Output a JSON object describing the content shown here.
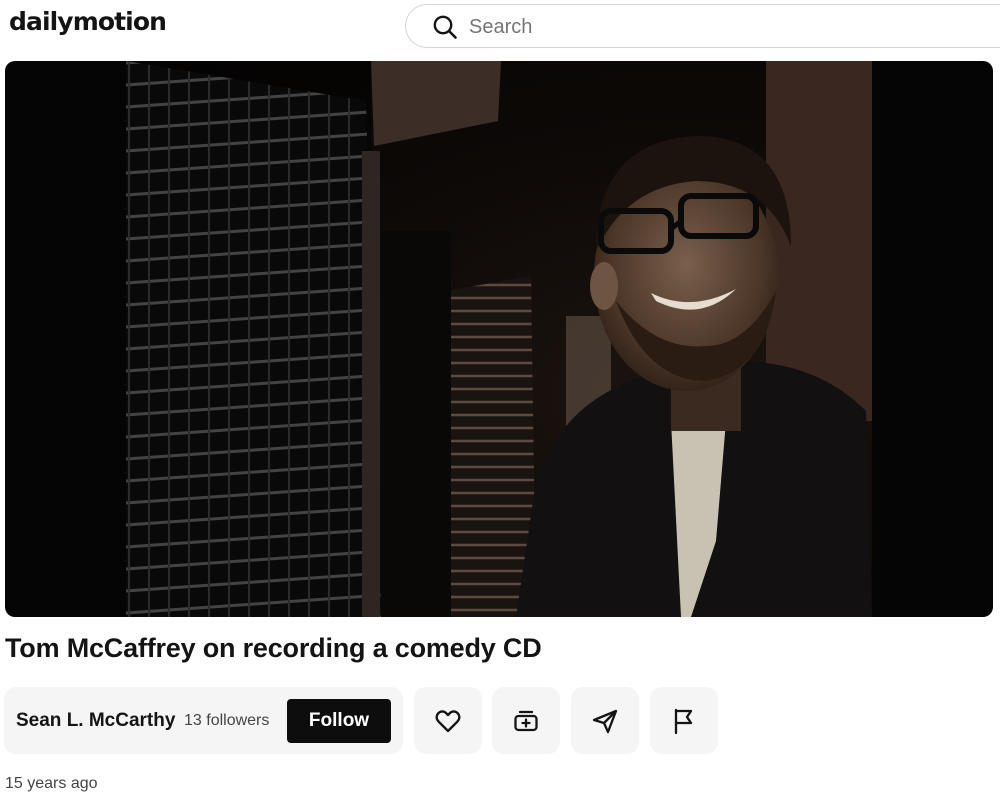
{
  "header": {
    "logo_text": "dailymotion",
    "search": {
      "placeholder": "Search",
      "icon": "search-icon"
    }
  },
  "video": {
    "title": "Tom McCaffrey on recording a comedy CD",
    "posted": "15 years ago"
  },
  "channel": {
    "name": "Sean L. McCarthy",
    "followers": "13 followers",
    "follow_label": "Follow"
  },
  "actions": [
    {
      "name": "like-button",
      "icon": "heart-icon"
    },
    {
      "name": "add-to-playlist-button",
      "icon": "playlist-add-icon"
    },
    {
      "name": "share-button",
      "icon": "send-icon"
    },
    {
      "name": "report-button",
      "icon": "flag-icon"
    }
  ],
  "colors": {
    "text": "#141414",
    "follow_bg": "#0d0d0d",
    "panel_bg": "#f5f5f5",
    "player_bg": "#050505"
  }
}
